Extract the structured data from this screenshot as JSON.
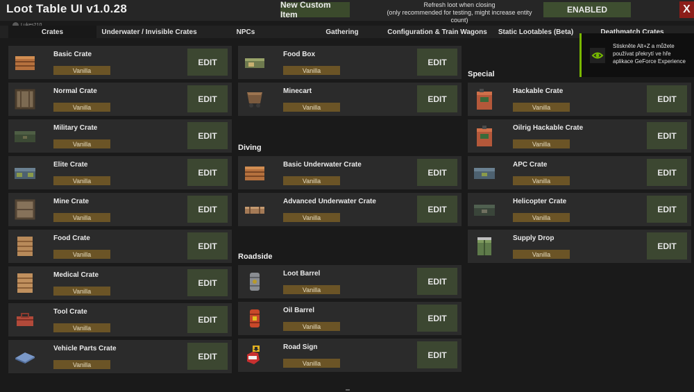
{
  "header": {
    "title": "Loot Table UI v1.0.28",
    "new_item_label": "New Custom Item",
    "refresh_line1": "Refresh loot when closing",
    "refresh_line2": "(only recommended for testing, might increase entity count)",
    "enabled_label": "ENABLED",
    "close_label": "X",
    "username": "Lukes210"
  },
  "tabs": [
    {
      "label": "Crates"
    },
    {
      "label": "Underwater / Invisible Crates"
    },
    {
      "label": "NPCs"
    },
    {
      "label": "Gathering"
    },
    {
      "label": "Configuration & Train Wagons"
    },
    {
      "label": "Static Lootables (Beta)"
    },
    {
      "label": "Deathmatch Crates"
    }
  ],
  "edit_label": "EDIT",
  "tag_label": "Vanilla",
  "columns": {
    "left": [
      {
        "name": "Basic Crate",
        "icon": "wooden-crate-icon"
      },
      {
        "name": "Normal Crate",
        "icon": "normal-crate-icon"
      },
      {
        "name": "Military Crate",
        "icon": "military-crate-icon"
      },
      {
        "name": "Elite Crate",
        "icon": "elite-crate-icon"
      },
      {
        "name": "Mine Crate",
        "icon": "mine-crate-icon"
      },
      {
        "name": "Food Crate",
        "icon": "food-crate-icon"
      },
      {
        "name": "Medical Crate",
        "icon": "medical-crate-icon"
      },
      {
        "name": "Tool Crate",
        "icon": "toolbox-icon"
      },
      {
        "name": "Vehicle Parts Crate",
        "icon": "vehicle-parts-crate-icon"
      }
    ],
    "middle_top": [
      {
        "name": "Food Box",
        "icon": "food-box-icon"
      },
      {
        "name": "Minecart",
        "icon": "minecart-icon"
      }
    ],
    "diving_title": "Diving",
    "diving": [
      {
        "name": "Basic Underwater Crate",
        "icon": "underwater-crate-icon"
      },
      {
        "name": "Advanced Underwater Crate",
        "icon": "advanced-underwater-crate-icon"
      }
    ],
    "roadside_title": "Roadside",
    "roadside": [
      {
        "name": "Loot Barrel",
        "icon": "loot-barrel-icon"
      },
      {
        "name": "Oil Barrel",
        "icon": "oil-barrel-icon"
      },
      {
        "name": "Road Sign",
        "icon": "road-sign-icon"
      }
    ],
    "special_title": "Special",
    "special": [
      {
        "name": "Hackable Crate",
        "icon": "hackable-crate-icon"
      },
      {
        "name": "Oilrig Hackable Crate",
        "icon": "oilrig-hackable-crate-icon"
      },
      {
        "name": "APC Crate",
        "icon": "apc-crate-icon"
      },
      {
        "name": "Helicopter Crate",
        "icon": "helicopter-crate-icon"
      },
      {
        "name": "Supply Drop",
        "icon": "supply-drop-icon"
      }
    ]
  },
  "overlay": {
    "message": "Stiskněte Alt+Z a můžete používat překrytí ve hře aplikace GeForce Experience"
  },
  "colors": {
    "background": "#1a1a1a",
    "card": "#2b2b2b",
    "edit_button": "#3c4731",
    "vanilla_tag": "#6b5426",
    "close_button": "#8c1d19"
  }
}
